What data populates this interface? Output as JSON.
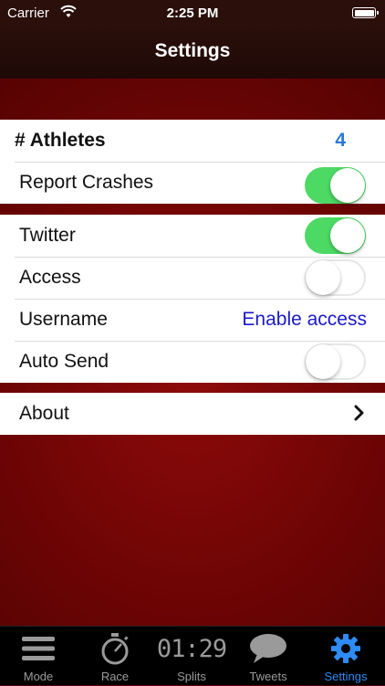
{
  "status_bar": {
    "carrier": "Carrier",
    "time": "2:25 PM"
  },
  "nav": {
    "title": "Settings"
  },
  "sections": {
    "general": {
      "athletes_label": "# Athletes",
      "athletes_value": "4",
      "report_crashes_label": "Report Crashes",
      "report_crashes_on": true
    },
    "twitter": {
      "twitter_label": "Twitter",
      "twitter_on": true,
      "access_label": "Access",
      "access_on": false,
      "username_label": "Username",
      "username_value": "Enable access",
      "auto_send_label": "Auto Send",
      "auto_send_on": false
    },
    "about": {
      "about_label": "About"
    }
  },
  "tabs": [
    {
      "label": "Mode",
      "icon": "hamburger-icon",
      "active": false
    },
    {
      "label": "Race",
      "icon": "stopwatch-icon",
      "active": false
    },
    {
      "label": "Splits",
      "icon": "digital-clock-icon",
      "digits": "01:29",
      "active": false
    },
    {
      "label": "Tweets",
      "icon": "speech-bubble-icon",
      "active": false
    },
    {
      "label": "Settings",
      "icon": "gear-icon",
      "active": true
    }
  ],
  "colors": {
    "accent": "#2f8bf5",
    "toggle_on": "#4cd964",
    "link": "#1a1acc"
  }
}
